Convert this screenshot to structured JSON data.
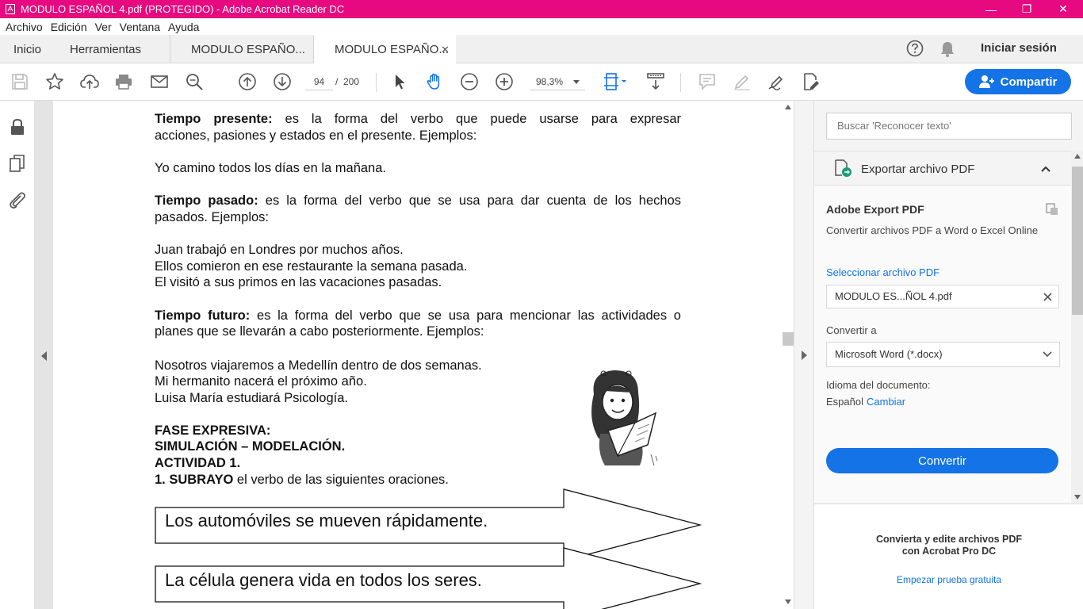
{
  "window": {
    "title": "MODULO ESPAÑOL 4.pdf (PROTEGIDO) - Adobe Acrobat Reader DC",
    "accent": "#e6097f",
    "minimize_glyph": "—",
    "restore_glyph": "❐",
    "close_glyph": "✕"
  },
  "menu": [
    "Archivo",
    "Edición",
    "Ver",
    "Ventana",
    "Ayuda"
  ],
  "tabs": {
    "home": "Inicio",
    "tools": "Herramientas",
    "doc1": "MODULO ESPAÑO...",
    "doc2": "MODULO ESPAÑO...",
    "close_glyph": "✕"
  },
  "header": {
    "signin": "Iniciar sesión",
    "help_icon": "question-circle-icon",
    "bell_icon": "bell-icon"
  },
  "toolbar": {
    "page_current": "94",
    "page_sep": "/",
    "page_total": "200",
    "zoom": "98,3%",
    "share_label": "Compartir",
    "share_color": "#1473e6"
  },
  "document": {
    "lines": [
      {
        "bold": "Tiempo presente:",
        "text": " es la forma del verbo que puede usarse para expresar"
      },
      {
        "bold": "",
        "text": "acciones, pasiones y estados en el presente. Ejemplos:"
      },
      {
        "bold": "",
        "text": "Yo camino todos los días en la mañana."
      },
      {
        "bold": "Tiempo pasado:",
        "text": " es la forma del verbo que se usa para dar cuenta de los hechos"
      },
      {
        "bold": "",
        "text": "pasados. Ejemplos:"
      },
      {
        "bold": "",
        "text": "Juan trabajó en Londres por muchos años."
      },
      {
        "bold": "",
        "text": "Ellos comieron en ese restaurante la semana pasada."
      },
      {
        "bold": "",
        "text": "El visitó a sus primos en las vacaciones pasadas."
      },
      {
        "bold": "Tiempo futuro:",
        "text": " es la forma del verbo que se usa para mencionar las actividades o"
      },
      {
        "bold": "",
        "text": "planes que se llevarán a cabo posteriormente. Ejemplos:"
      },
      {
        "bold": "",
        "text": "Nosotros viajaremos a Medellín dentro de dos semanas."
      },
      {
        "bold": "",
        "text": "Mi hermanito nacerá el próximo año."
      },
      {
        "bold": "",
        "text": "Luisa María estudiará Psicología."
      },
      {
        "bold": "FASE EXPRESIVA:",
        "text": ""
      },
      {
        "bold": "SIMULACIÓN – MODELACIÓN.",
        "text": ""
      },
      {
        "bold": "ACTIVIDAD 1.",
        "text": ""
      },
      {
        "bold": "1. SUBRAYO",
        "text": " el verbo de las siguientes oraciones."
      }
    ],
    "arrows": [
      "Los automóviles se mueven rápidamente.",
      "La célula genera vida en todos los seres."
    ]
  },
  "right_panel": {
    "search_placeholder": "Buscar 'Reconocer texto'",
    "export_title": "Exportar archivo PDF",
    "adobe_export": "Adobe Export PDF",
    "adobe_export_desc": "Convertir archivos PDF a Word o Excel Online",
    "select_file_label": "Seleccionar archivo PDF",
    "selected_file": "MODULO ES...ÑOL 4.pdf",
    "convert_to_label": "Convertir a",
    "convert_to_value": "Microsoft Word (*.docx)",
    "language_label": "Idioma del documento:",
    "language_value": "Español",
    "change_link": "Cambiar",
    "convert_button": "Convertir",
    "promo_line1": "Convierta y edite archivos PDF",
    "promo_line2": "con Acrobat Pro DC",
    "trial_link": "Empezar prueba gratuita",
    "link_color": "#1473e6"
  }
}
